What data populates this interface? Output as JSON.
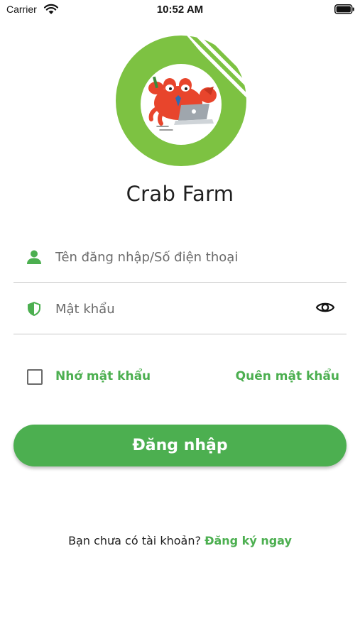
{
  "status_bar": {
    "carrier": "Carrier",
    "time": "10:52 AM"
  },
  "app": {
    "title": "Crab Farm"
  },
  "form": {
    "username_placeholder": "Tên đăng nhập/Số điện thoại",
    "username_value": "",
    "password_placeholder": "Mật khẩu",
    "password_value": "",
    "remember_checked": false,
    "remember_label": "Nhớ mật khẩu",
    "forgot_label": "Quên mật khẩu",
    "login_label": "Đăng nhập"
  },
  "signup": {
    "prompt": "Bạn chưa có tài khoản?",
    "link": "Đăng ký ngay"
  },
  "colors": {
    "accent": "#4caf50",
    "logo_ring": "#7dc242",
    "text_dark": "#1f1f1f",
    "placeholder": "#6b6b6b"
  },
  "icons": {
    "wifi": "wifi-icon",
    "battery": "battery-icon",
    "user": "user-icon",
    "shield": "shield-icon",
    "eye": "eye-icon",
    "logo": "crab-logo"
  }
}
